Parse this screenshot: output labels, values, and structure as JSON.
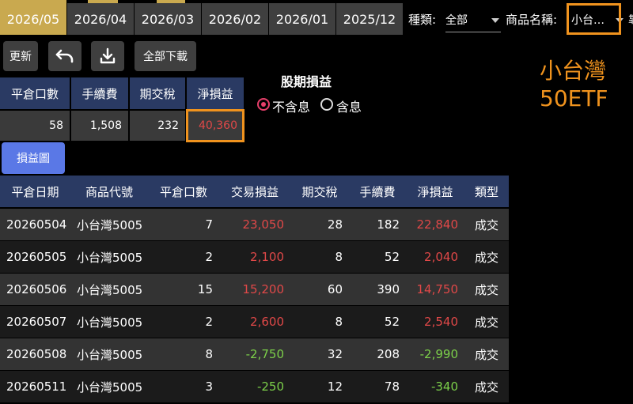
{
  "month_tabs": [
    "2026/05",
    "2026/04",
    "2026/03",
    "2026/02",
    "2026/01",
    "2025/12"
  ],
  "active_tab": "2026/05",
  "filters": {
    "type_label": "種類:",
    "type_value": "全部",
    "product_label": "商品名稱:",
    "product_value": "小台…",
    "trailing_char": "靠"
  },
  "toolbar": {
    "refresh_label": "更新",
    "undo_icon": "undo-arrow-icon",
    "download_icon": "download-icon",
    "download_all_label": "全部下載"
  },
  "annotation": {
    "line1": "小台灣",
    "line2": "50ETF",
    "color": "#f0931e"
  },
  "summary": {
    "headers": [
      "平倉口數",
      "手續費",
      "期交稅",
      "淨損益"
    ],
    "values": [
      "58",
      "1,508",
      "232",
      "40,360"
    ]
  },
  "dividend": {
    "title": "股期損益",
    "option_excl": "不含息",
    "option_incl": "含息",
    "selected": "不含息"
  },
  "pnl_chart_button": "損益圖",
  "table": {
    "headers": [
      "平倉日期",
      "商品代號",
      "平倉口數",
      "交易損益",
      "期交稅",
      "手續費",
      "淨損益",
      "類型"
    ],
    "rows": [
      [
        "20260504",
        "小台灣5005",
        "7",
        "23,050",
        "28",
        "182",
        "22,840",
        "成交"
      ],
      [
        "20260505",
        "小台灣5005",
        "2",
        "2,100",
        "8",
        "52",
        "2,040",
        "成交"
      ],
      [
        "20260506",
        "小台灣5005",
        "15",
        "15,200",
        "60",
        "390",
        "14,750",
        "成交"
      ],
      [
        "20260507",
        "小台灣5005",
        "2",
        "2,600",
        "8",
        "52",
        "2,540",
        "成交"
      ],
      [
        "20260508",
        "小台灣5005",
        "8",
        "-2,750",
        "32",
        "208",
        "-2,990",
        "成交"
      ],
      [
        "20260511",
        "小台灣5005",
        "3",
        "-250",
        "12",
        "78",
        "-340",
        "成交"
      ]
    ]
  },
  "colors": {
    "tab_active": "#c9a94f",
    "header_bg": "#2a3a63",
    "profit": "#e04848",
    "loss": "#7cd04a",
    "highlight_box": "#f0931e",
    "button_blue": "#5a78e6"
  }
}
